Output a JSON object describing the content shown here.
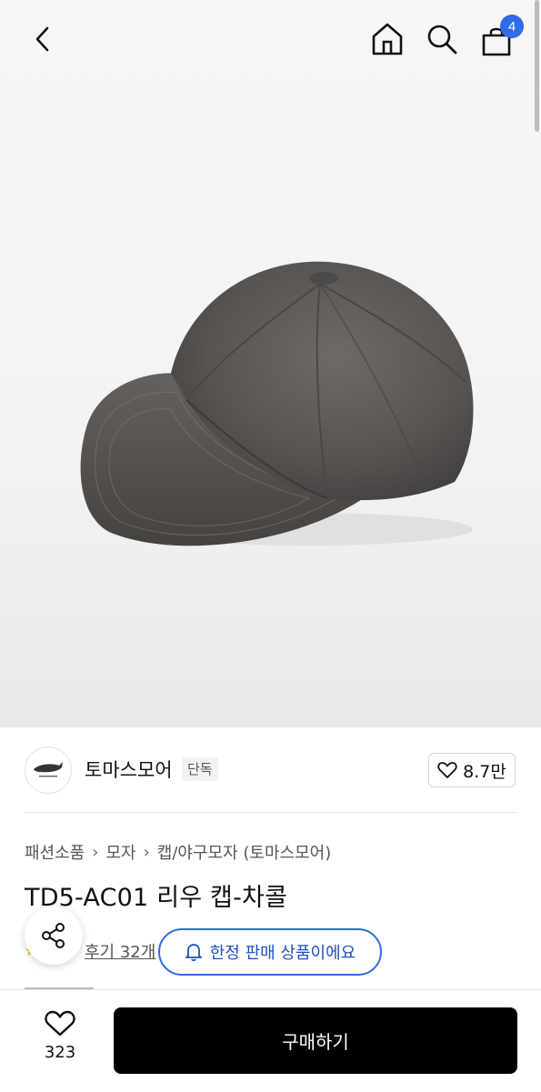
{
  "header": {
    "back_icon": "chevron-left-icon",
    "home_icon": "home-icon",
    "search_icon": "search-icon",
    "cart_icon": "shopping-bag-icon",
    "cart_count": "4"
  },
  "hero": {
    "image": "charcoal-cap-product-photo"
  },
  "brand": {
    "name": "토마스모어",
    "badge": "단독",
    "like_count": "8.7만"
  },
  "breadcrumb": {
    "items": [
      "패션소품",
      "모자",
      "캡/야구모자 (토마스모어)"
    ]
  },
  "product": {
    "title": "TD5-AC01 리우 캡-차콜",
    "reviews": "후기 32개"
  },
  "notice": {
    "limited_label": "한정 판매 상품이에요"
  },
  "bottom": {
    "wish_count": "323",
    "buy_label": "구매하기"
  },
  "colors": {
    "accent": "#2f6ae8",
    "primary_button": "#000000"
  }
}
